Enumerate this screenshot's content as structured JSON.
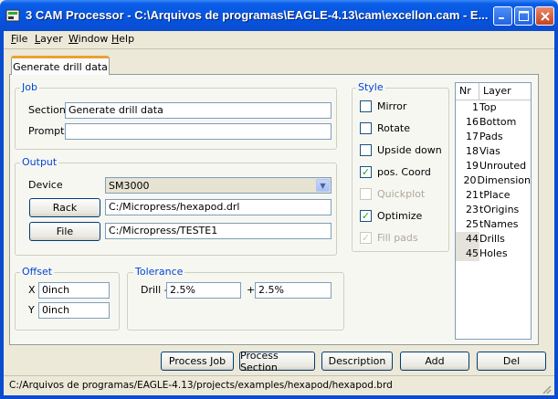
{
  "window": {
    "title": "3 CAM Processor - C:\\Arquivos de programas\\EAGLE-4.13\\cam\\excellon.cam - E...",
    "controls": [
      "minimize-icon",
      "maximize-icon",
      "close-icon"
    ]
  },
  "menu": [
    {
      "first": "F",
      "rest": "ile"
    },
    {
      "first": "L",
      "rest": "ayer"
    },
    {
      "first": "W",
      "rest": "indow"
    },
    {
      "first": "H",
      "rest": "elp"
    }
  ],
  "tab": {
    "label": "Generate drill data"
  },
  "job": {
    "group_label": "Job",
    "section_label": "Section",
    "section_value": "Generate drill data",
    "prompt_label": "Prompt",
    "prompt_value": ""
  },
  "output": {
    "group_label": "Output",
    "device_label": "Device",
    "device_value": "SM3000",
    "rack_button": "Rack",
    "rack_value": "C:/Micropress/hexapod.drl",
    "file_button": "File",
    "file_value": "C:/Micropress/TESTE1"
  },
  "offset": {
    "group_label": "Offset",
    "x_label": "X",
    "x_value": "0inch",
    "y_label": "Y",
    "y_value": "0inch"
  },
  "tolerance": {
    "group_label": "Tolerance",
    "drill_label": "Drill -",
    "minus_value": "2.5%",
    "plus_label": "+",
    "plus_value": "2.5%"
  },
  "style": {
    "group_label": "Style",
    "options": [
      {
        "label": "Mirror",
        "checked": false,
        "enabled": true
      },
      {
        "label": "Rotate",
        "checked": false,
        "enabled": true
      },
      {
        "label": "Upside down",
        "checked": false,
        "enabled": true
      },
      {
        "label": "pos. Coord",
        "checked": true,
        "enabled": true
      },
      {
        "label": "Quickplot",
        "checked": false,
        "enabled": false
      },
      {
        "label": "Optimize",
        "checked": true,
        "enabled": true
      },
      {
        "label": "Fill pads",
        "checked": true,
        "enabled": false
      }
    ]
  },
  "layers": {
    "header_nr": "Nr",
    "header_layer": "Layer",
    "rows": [
      {
        "nr": "1",
        "name": "Top",
        "selected": false
      },
      {
        "nr": "16",
        "name": "Bottom",
        "selected": false
      },
      {
        "nr": "17",
        "name": "Pads",
        "selected": false
      },
      {
        "nr": "18",
        "name": "Vias",
        "selected": false
      },
      {
        "nr": "19",
        "name": "Unrouted",
        "selected": false
      },
      {
        "nr": "20",
        "name": "Dimension",
        "selected": false
      },
      {
        "nr": "21",
        "name": "tPlace",
        "selected": false
      },
      {
        "nr": "23",
        "name": "tOrigins",
        "selected": false
      },
      {
        "nr": "25",
        "name": "tNames",
        "selected": false
      },
      {
        "nr": "44",
        "name": "Drills",
        "selected": true
      },
      {
        "nr": "45",
        "name": "Holes",
        "selected": true
      }
    ]
  },
  "buttons": {
    "process_job": "Process Job",
    "process_section": "Process Section",
    "description": "Description",
    "add": "Add",
    "del": "Del"
  },
  "status": {
    "text": "C:/Arquivos de programas/EAGLE-4.13/projects/examples/hexapod/hexapod.brd"
  },
  "colors": {
    "titlebar": "#0554e0",
    "accent_label": "#0046d5",
    "check": "#21a121"
  }
}
